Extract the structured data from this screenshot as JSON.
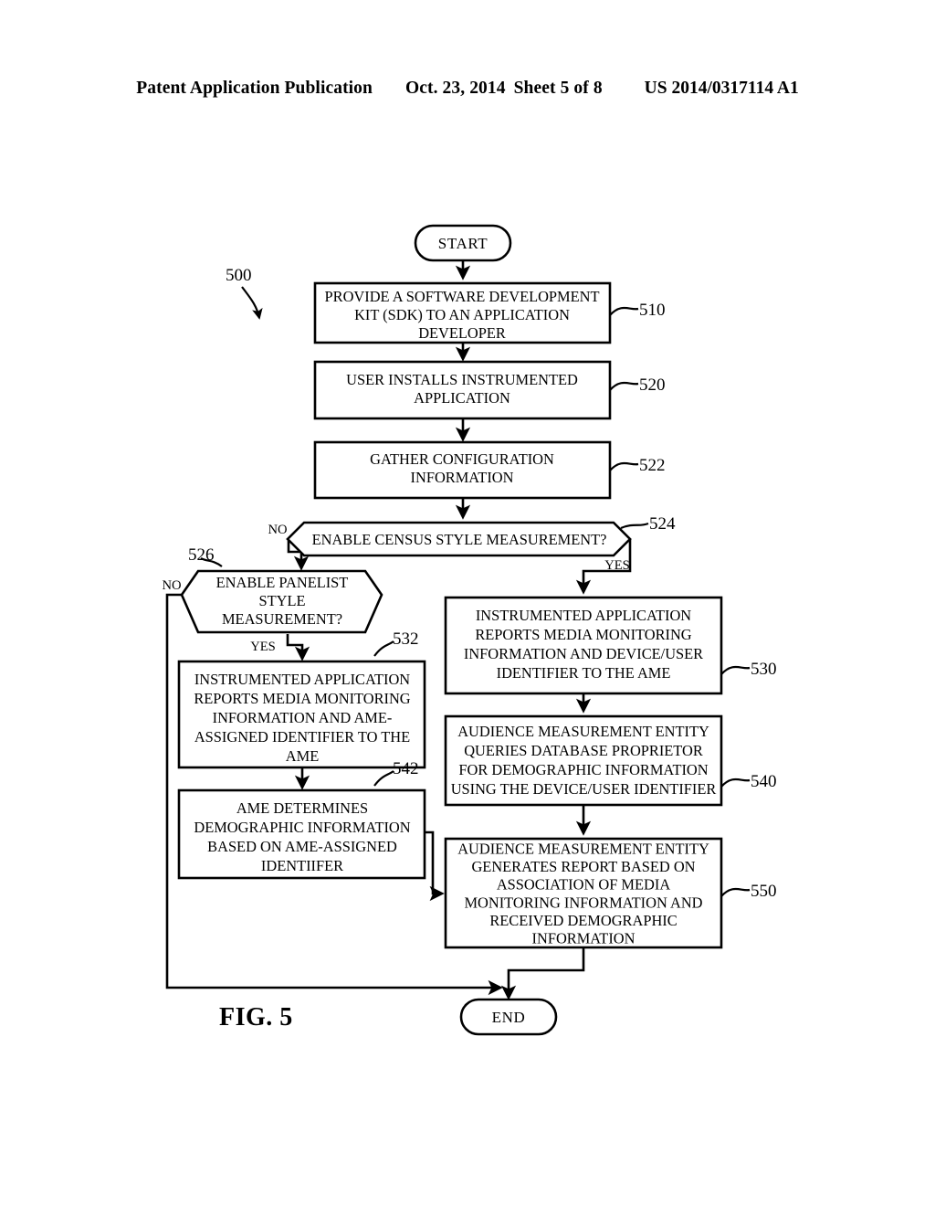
{
  "header": {
    "publication": "Patent Application Publication",
    "date": "Oct. 23, 2014",
    "sheet": "Sheet 5 of 8",
    "number": "US 2014/0317114 A1"
  },
  "figure": {
    "label": "FIG. 5",
    "diagram_ref": "500"
  },
  "nodes": {
    "start": {
      "text": "START"
    },
    "end": {
      "text": "END"
    },
    "n510": {
      "ref": "510",
      "lines": [
        "PROVIDE A SOFTWARE DEVELOPMENT",
        "KIT (SDK) TO AN APPLICATION",
        "DEVELOPER"
      ]
    },
    "n520": {
      "ref": "520",
      "lines": [
        "USER INSTALLS INSTRUMENTED",
        "APPLICATION"
      ]
    },
    "n522": {
      "ref": "522",
      "lines": [
        "GATHER CONFIGURATION",
        "INFORMATION"
      ]
    },
    "n524": {
      "ref": "524",
      "lines": [
        "ENABLE CENSUS STYLE MEASUREMENT?"
      ]
    },
    "n526": {
      "ref": "526",
      "lines": [
        "ENABLE PANELIST",
        "STYLE",
        "MEASUREMENT?"
      ]
    },
    "n530": {
      "ref": "530",
      "lines": [
        "INSTRUMENTED APPLICATION",
        "REPORTS MEDIA MONITORING",
        "INFORMATION AND DEVICE/USER",
        "IDENTIFIER TO THE AME"
      ]
    },
    "n532": {
      "ref": "532",
      "lines": [
        "INSTRUMENTED APPLICATION",
        "REPORTS MEDIA MONITORING",
        "INFORMATION AND AME-",
        "ASSIGNED IDENTIFIER TO THE",
        "AME"
      ]
    },
    "n540": {
      "ref": "540",
      "lines": [
        "AUDIENCE MEASUREMENT ENTITY",
        "QUERIES DATABASE PROPRIETOR",
        "FOR DEMOGRAPHIC INFORMATION",
        "USING THE DEVICE/USER IDENTIFIER"
      ]
    },
    "n542": {
      "ref": "542",
      "lines": [
        "AME DETERMINES",
        "DEMOGRAPHIC INFORMATION",
        "BASED ON AME-ASSIGNED",
        "IDENTIIFER"
      ]
    },
    "n550": {
      "ref": "550",
      "lines": [
        "AUDIENCE MEASUREMENT ENTITY",
        "GENERATES REPORT BASED ON",
        "ASSOCIATION OF MEDIA",
        "MONITORING INFORMATION AND",
        "RECEIVED DEMOGRAPHIC",
        "INFORMATION"
      ]
    }
  },
  "edge_labels": {
    "census_no": "NO",
    "census_yes": "YES",
    "panelist_no": "NO",
    "panelist_yes": "YES"
  },
  "colors": {
    "ink": "#000000",
    "paper": "#ffffff"
  }
}
